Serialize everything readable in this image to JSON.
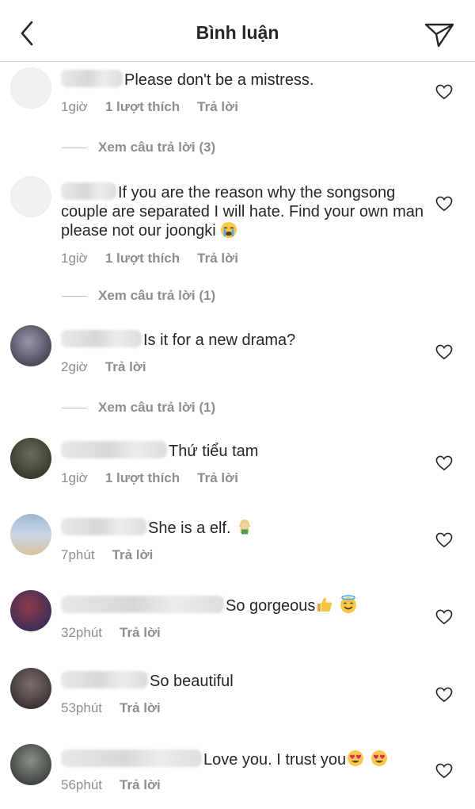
{
  "header": {
    "title": "Bình luận"
  },
  "labels": {
    "reply": "Trả lời",
    "likes": "1 lượt thích"
  },
  "comments": [
    {
      "text": "Please don't be a mistress.",
      "time": "1giờ",
      "likes": "1 lượt thích",
      "reply": "Trả lời",
      "more_replies": "Xem câu trả lời (3)"
    },
    {
      "text": "If you are the reason why the songsong couple are separated I will hate. Find your own man please not our joongki",
      "time": "1giờ",
      "likes": "1 lượt thích",
      "reply": "Trả lời",
      "more_replies": "Xem câu trả lời (1)",
      "emoji": "crying-face"
    },
    {
      "text": "Is it for a new drama?",
      "time": "2giờ",
      "reply": "Trả lời",
      "more_replies": "Xem câu trả lời (1)"
    },
    {
      "text": "Thứ tiểu tam",
      "time": "1giờ",
      "likes": "1 lượt thích",
      "reply": "Trả lời"
    },
    {
      "text": "She is a elf.",
      "time": "7phút",
      "reply": "Trả lời",
      "emoji": "elf"
    },
    {
      "text": "So gorgeous",
      "time": "32phút",
      "reply": "Trả lời",
      "emoji": "thumbs-up, smiling-face-with-halo"
    },
    {
      "text": "So beautiful",
      "time": "53phút",
      "reply": "Trả lời"
    },
    {
      "text": "Love you. I trust you",
      "time": "56phút",
      "reply": "Trả lời",
      "emoji": "heart-eyes, heart-eyes"
    }
  ],
  "colors": {
    "text": "#262626",
    "muted": "#8e8e8e",
    "divider": "#dbdbdb"
  }
}
